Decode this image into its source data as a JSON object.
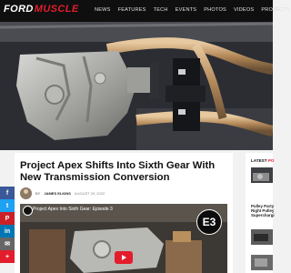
{
  "site": {
    "logo_main": "FORD",
    "logo_accent": "MUSCLE"
  },
  "nav": [
    "NEWS",
    "FEATURES",
    "TECH",
    "EVENTS",
    "PHOTOS",
    "VIDEOS",
    "PROJECTS"
  ],
  "article": {
    "title": "Project Apex Shifts Into Sixth Gear With New Transmission Conversion",
    "by": "BY",
    "author": "JAMES ELKINS",
    "date": "AUGUST 29, 2022"
  },
  "video": {
    "title": "Project Apex Into Sixth Gear: Episode 3",
    "badge": "E3"
  },
  "share": [
    {
      "icon": "facebook-icon",
      "glyph": "f",
      "color": "#3b5998"
    },
    {
      "icon": "twitter-icon",
      "glyph": "t",
      "color": "#1da1f2"
    },
    {
      "icon": "pinterest-icon",
      "glyph": "P",
      "color": "#cb2027"
    },
    {
      "icon": "linkedin-icon",
      "glyph": "in",
      "color": "#0077b5"
    },
    {
      "icon": "email-icon",
      "glyph": "✉",
      "color": "#666666"
    },
    {
      "icon": "share-icon",
      "glyph": "+",
      "color": "#e31d2b"
    }
  ],
  "sidebar": {
    "heading_main": "LATEST",
    "heading_accent": "PO",
    "item1_lines": [
      "Pulley Party",
      "Right Pulley",
      "Superchargi"
    ]
  },
  "colors": {
    "accent": "#e31d2b",
    "header_bg": "#0f0f10"
  }
}
